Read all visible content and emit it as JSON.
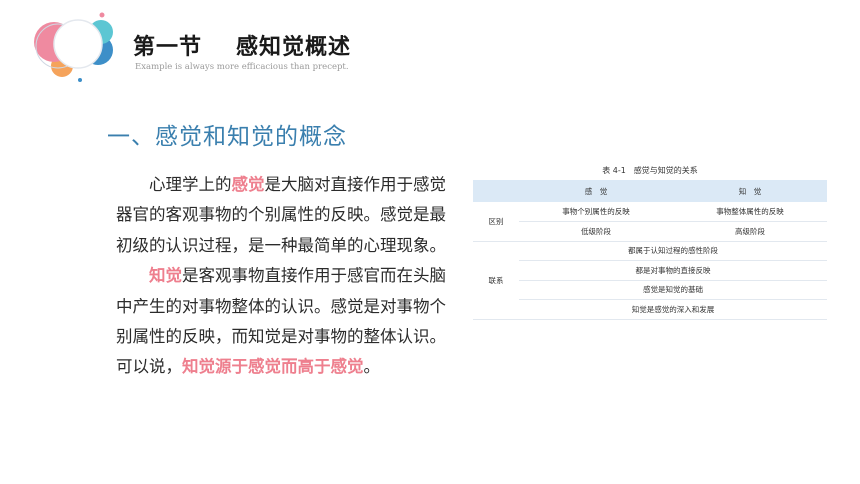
{
  "header": {
    "section_number": "第一节",
    "section_name": "感知觉概述",
    "motto": "Example is always more efficacious than precept."
  },
  "heading": "一、感觉和知觉的概念",
  "body": {
    "p1_before": "心理学上的",
    "p1_term": "感觉",
    "p1_after": "是大脑对直接作用于感觉器官的客观事物的个别属性的反映。感觉是最初级的认识过程，是一种最简单的心理现象。",
    "p2_term": "知觉",
    "p2_mid": "是客观事物直接作用于感官而在头脑中产生的对事物整体的认识。感觉是对事物个别属性的反映，而知觉是对事物的整体认识。可以说，",
    "p2_conclusion": "知觉源于感觉而高于感觉",
    "p2_end": "。"
  },
  "table": {
    "caption": "表 4-1　感觉与知觉的关系",
    "col_headers": [
      "感　觉",
      "知　觉"
    ],
    "group1_label": "区别",
    "group1_rows": [
      [
        "事物个别属性的反映",
        "事物整体属性的反映"
      ],
      [
        "低级阶段",
        "高级阶段"
      ]
    ],
    "group2_label": "联系",
    "group2_rows": [
      "都属于认知过程的感性阶段",
      "都是对事物的直接反映",
      "感觉是知觉的基础",
      "知觉是感觉的深入和发展"
    ]
  },
  "colors": {
    "heading_blue": "#3a7fae",
    "highlight_pink": "#ee7f8e",
    "table_header_bg": "#dbe9f6"
  }
}
